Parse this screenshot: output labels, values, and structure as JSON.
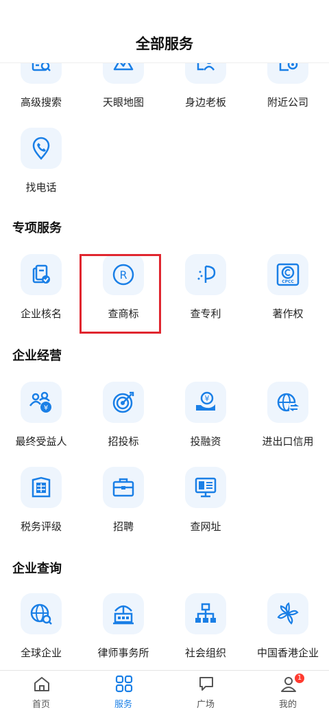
{
  "header": {
    "title": "全部服务"
  },
  "top_items": [
    "高级搜索",
    "天眼地图",
    "身边老板",
    "附近公司",
    "找电话"
  ],
  "sections": {
    "special": {
      "title": "专项服务",
      "items": [
        "企业核名",
        "查商标",
        "查专利",
        "著作权"
      ]
    },
    "operation": {
      "title": "企业经营",
      "items": [
        "最终受益人",
        "招投标",
        "投融资",
        "进出口信用",
        "税务评级",
        "招聘",
        "查网址"
      ]
    },
    "query": {
      "title": "企业查询",
      "items": [
        "全球企业",
        "律师事务所",
        "社会组织",
        "中国香港企业"
      ]
    }
  },
  "icon_text": {
    "cpcc": "CPCC",
    "yen": "¥",
    "r": "R"
  },
  "tabbar": {
    "tabs": [
      "首页",
      "服务",
      "广场",
      "我的"
    ],
    "active": "服务",
    "badge": "1"
  },
  "colors": {
    "accent": "#1a7fe6",
    "icon_bg": "#eef5fd",
    "highlight": "#e0262f",
    "badge": "#ff3b30"
  }
}
